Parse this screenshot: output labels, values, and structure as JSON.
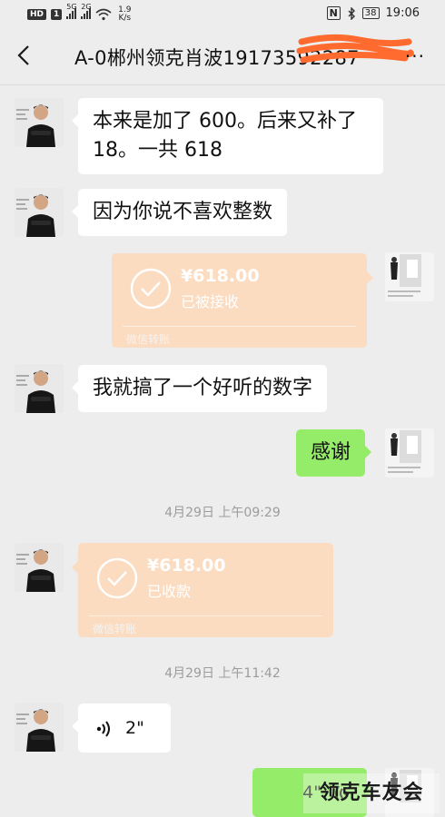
{
  "status_bar": {
    "hd": "HD",
    "sim1": "1",
    "net1": "5G",
    "net2": "2G",
    "speed_value": "1.9",
    "speed_unit": "K/s",
    "battery": "38",
    "time": "19:06"
  },
  "header": {
    "title": "A-0郴州领克肖波19173592287"
  },
  "messages": {
    "m1": {
      "line1": "本来是加了 600。后来又补了",
      "line2": "18。一共 618"
    },
    "m2": "因为你说不喜欢整数",
    "t1": {
      "amount": "¥618.00",
      "status": "已被接收",
      "footer": "微信转账"
    },
    "m3": "我就搞了一个好听的数字",
    "m4": "感谢",
    "ts1": "4月29日 上午09:29",
    "t2": {
      "amount": "¥618.00",
      "status": "已收款",
      "footer": "微信转账"
    },
    "ts2": "4月29日 上午11:42",
    "v1": "2\"",
    "v2": "4\""
  },
  "watermark": "领克车友会",
  "colors": {
    "background": "#ededed",
    "bubble_self": "#95ec69",
    "bubble_other": "#ffffff",
    "transfer_card": "#fcdcc0",
    "scribble": "#ff6a2f"
  }
}
